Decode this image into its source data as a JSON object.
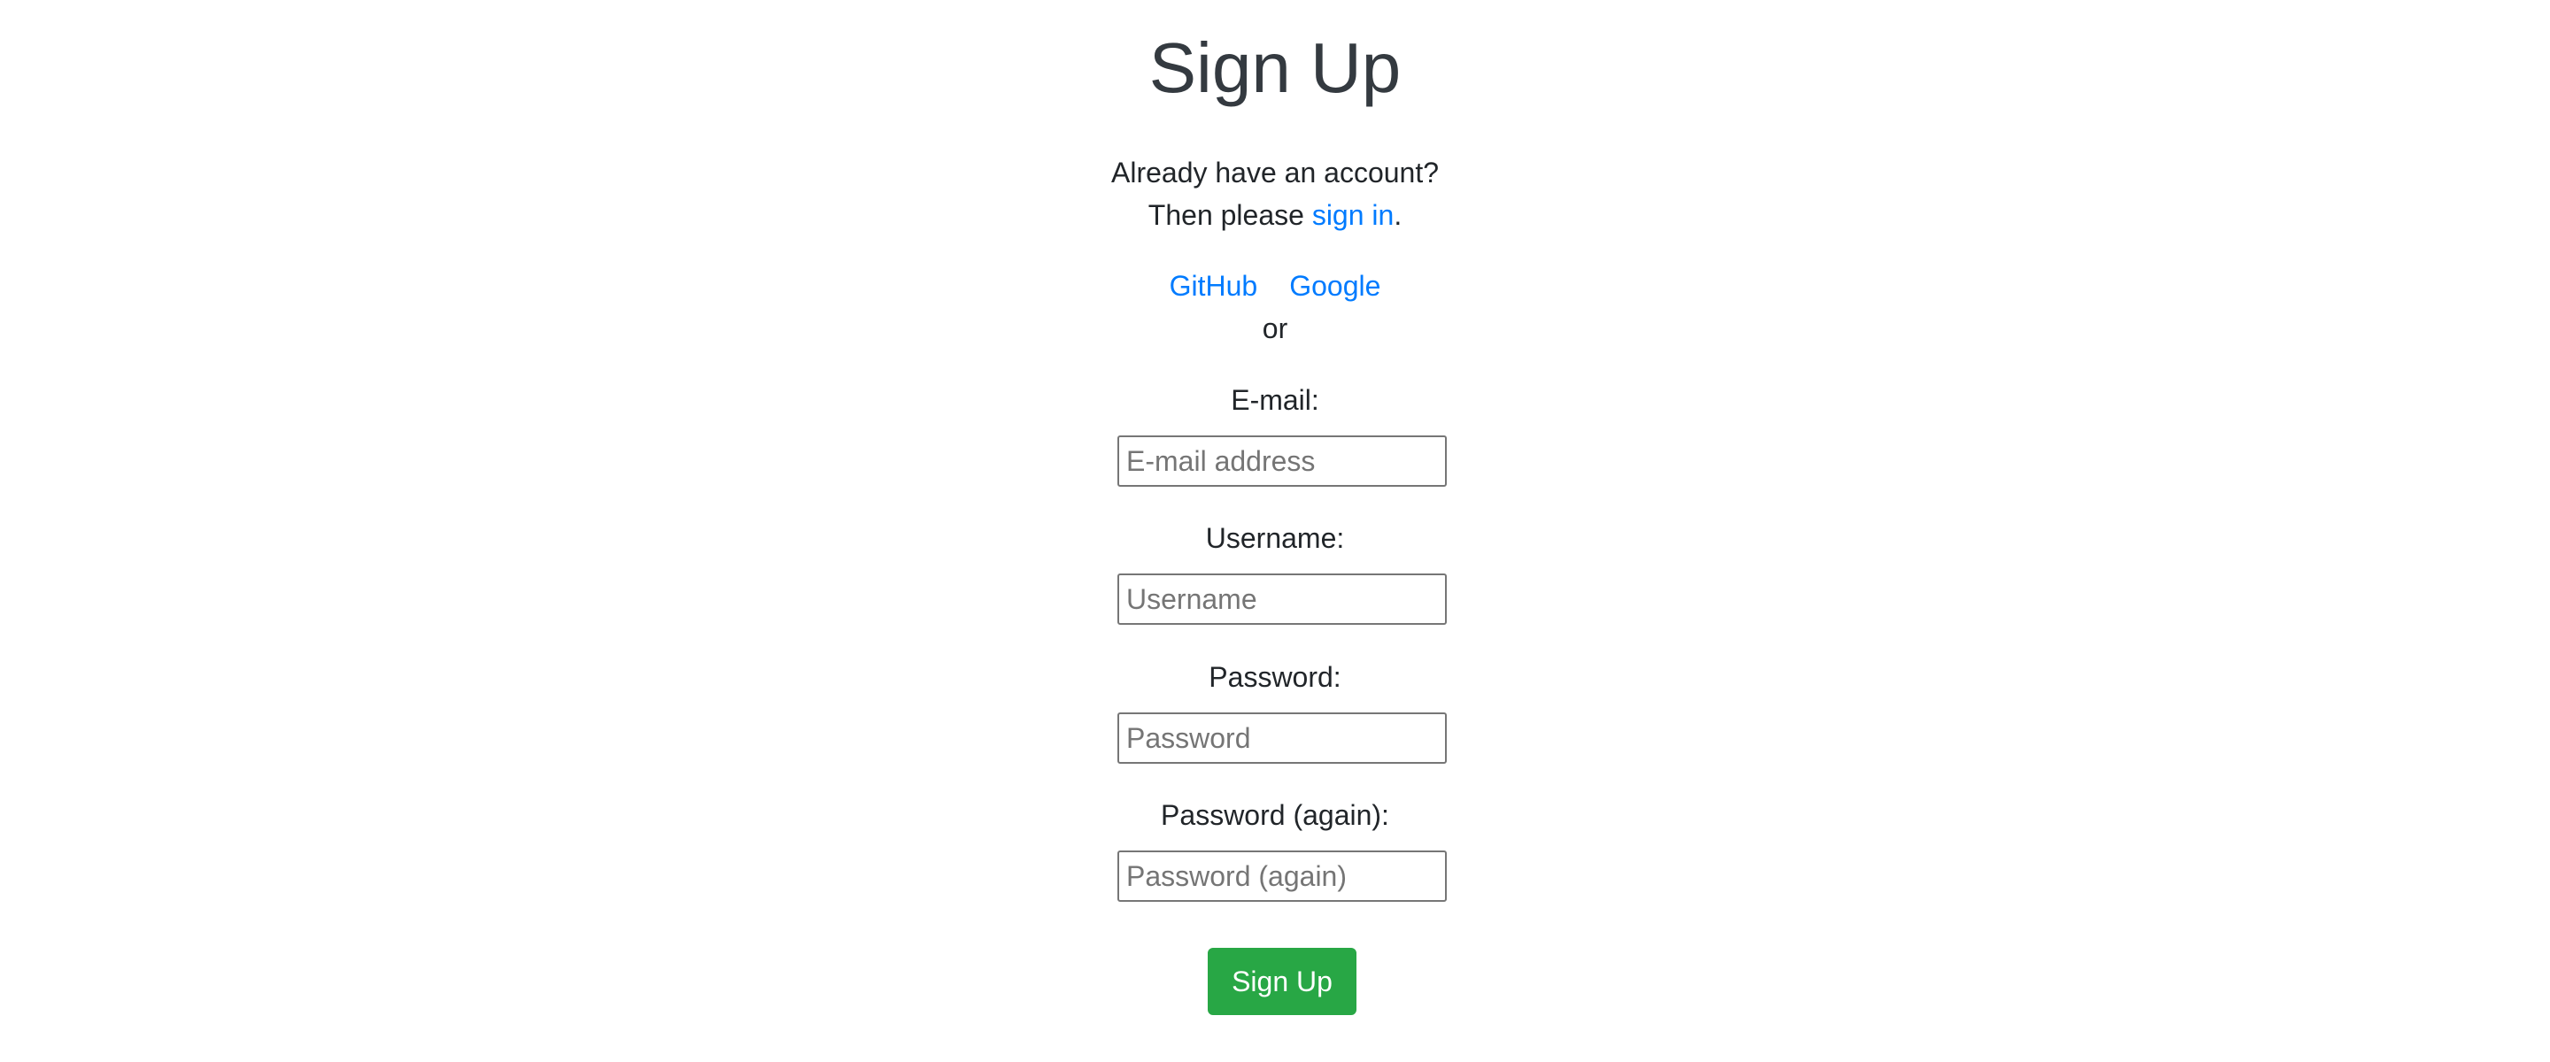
{
  "page": {
    "title": "Sign Up"
  },
  "intro": {
    "line1": "Already have an account?",
    "line2_prefix": "Then please ",
    "signin_link": "sign in",
    "line2_suffix": "."
  },
  "social": {
    "providers": [
      "GitHub",
      "Google"
    ],
    "separator": "or"
  },
  "form": {
    "email": {
      "label": "E-mail:",
      "placeholder": "E-mail address",
      "value": ""
    },
    "username": {
      "label": "Username:",
      "placeholder": "Username",
      "value": ""
    },
    "password": {
      "label": "Password:",
      "placeholder": "Password",
      "value": ""
    },
    "password2": {
      "label": "Password (again):",
      "placeholder": "Password (again)",
      "value": ""
    },
    "submit_label": "Sign Up"
  },
  "colors": {
    "link": "#007bff",
    "button": "#28a745",
    "title": "#343a40"
  }
}
